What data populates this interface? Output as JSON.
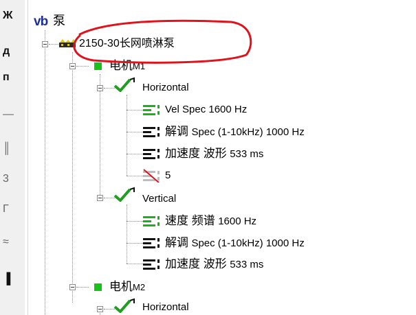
{
  "toolbar": {
    "glyphs": [
      "Ж",
      "д",
      "п",
      "—",
      "║",
      "3",
      "Г",
      "≈",
      "▐"
    ]
  },
  "tree": {
    "root": {
      "icon": "vb-logo-icon",
      "logo": "vb",
      "label": "泵"
    },
    "machine": {
      "icon": "pump-machine-icon",
      "label": "2150-30长网喷淋泵"
    },
    "motor1": {
      "label": "电机",
      "suffix": "M1",
      "horizontal": {
        "label": "Horizontal",
        "items": [
          {
            "label": "Vel Spec 1600 Hz",
            "icon": "spectrum-green-icon"
          },
          {
            "label_cn": "解调",
            "label": "Spec (1-10kHz) 1000 Hz",
            "icon": "spectrum-black-icon"
          },
          {
            "label_cn": "加速度 波形",
            "label": "533 ms",
            "icon": "waveform-black-icon"
          },
          {
            "label": "5",
            "icon": "disabled-measurement-icon"
          }
        ]
      },
      "vertical": {
        "label": "Vertical",
        "items": [
          {
            "label_cn": "速度 频谱",
            "label": "1600 Hz",
            "icon": "spectrum-green-icon"
          },
          {
            "label_cn": "解调",
            "label": "Spec (1-10kHz) 1000 Hz",
            "icon": "spectrum-black-icon"
          },
          {
            "label_cn": "加速度 波形",
            "label": "533 ms",
            "icon": "waveform-black-icon"
          }
        ]
      }
    },
    "motor2": {
      "label": "电机",
      "suffix": "M2",
      "horizontal": {
        "label": "Horizontal"
      }
    }
  },
  "colors": {
    "annotation": "#e0121b",
    "status_green": "#19c219",
    "logo_blue": "#1b2e9a"
  }
}
